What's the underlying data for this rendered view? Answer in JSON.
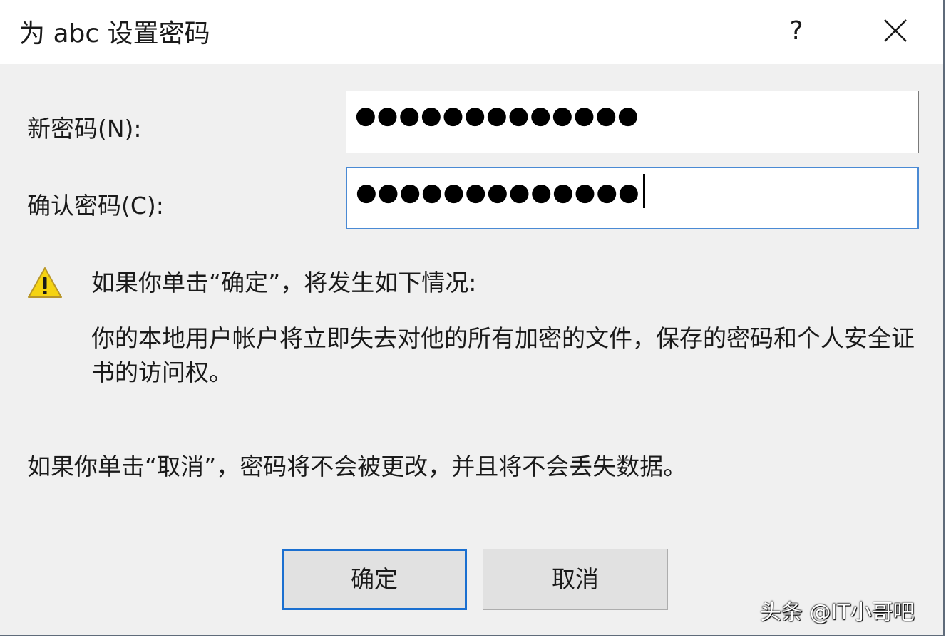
{
  "dialog": {
    "title": "为 abc 设置密码",
    "help_label": "?",
    "close_icon": "close-icon"
  },
  "form": {
    "new_password_label": "新密码(N):",
    "new_password_value": "●●●●●●●●●●●●●",
    "confirm_password_label": "确认密码(C):",
    "confirm_password_value": "●●●●●●●●●●●●●"
  },
  "warning": {
    "icon": "warning-icon",
    "headline": "如果你单击“确定”，将发生如下情况:",
    "detail": "你的本地用户帐户将立即失去对他的所有加密的文件，保存的密码和个人安全证书的访问权。"
  },
  "cancel_note": "如果你单击“取消”，密码将不会被更改，并且将不会丢失数据。",
  "buttons": {
    "ok_label": "确定",
    "cancel_label": "取消"
  },
  "watermark": "头条 @IT小哥吧",
  "colors": {
    "focus_border": "#4a8ad4",
    "default_button_border": "#1a6fd0",
    "warning_yellow": "#f5d312"
  }
}
